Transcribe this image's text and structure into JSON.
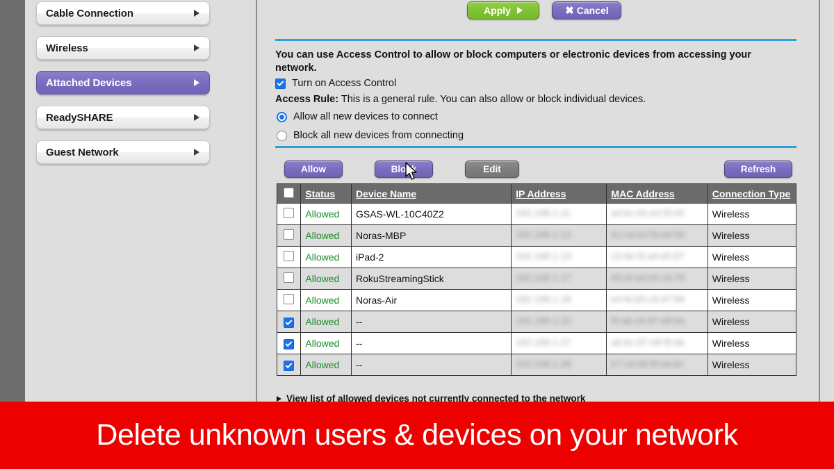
{
  "sidebar": {
    "items": [
      {
        "label": "Cable Connection",
        "active": false,
        "icon": "chevron-right-icon"
      },
      {
        "label": "Wireless",
        "active": false,
        "icon": "chevron-right-icon"
      },
      {
        "label": "Attached Devices",
        "active": true,
        "icon": "chevron-right-icon"
      },
      {
        "label": "ReadySHARE",
        "active": false,
        "icon": "chevron-right-icon"
      },
      {
        "label": "Guest Network",
        "active": false,
        "icon": "chevron-right-icon"
      }
    ]
  },
  "toolbar": {
    "apply_label": "Apply",
    "apply_icon": "play-triangle-icon",
    "apply_color": "#7fc236",
    "cancel_label": "Cancel",
    "cancel_icon": "x-close-icon",
    "cancel_color": "#7a6dc0"
  },
  "content": {
    "intro": "You can use Access Control to allow or block computers or electronic devices from accessing your network.",
    "turn_on_label": "Turn on Access Control",
    "turn_on_checked": true,
    "access_rule_label": "Access Rule:",
    "access_rule_text": " This is a general rule. You can also allow or block individual devices.",
    "radio_allow_label": "Allow all new devices to connect",
    "radio_block_label": "Block all new devices from connecting",
    "radio_selected": "allow",
    "rule_color": "#2e9fd4"
  },
  "actions": {
    "allow_label": "Allow",
    "block_label": "Block",
    "edit_label": "Edit",
    "refresh_label": "Refresh",
    "edit_disabled": true
  },
  "table": {
    "columns": [
      "",
      "Status",
      "Device Name",
      "IP Address",
      "MAC Address",
      "Connection Type"
    ],
    "header_select_all_checked": false,
    "status_color": "#1a8c2a",
    "rows": [
      {
        "checked": false,
        "status": "Allowed",
        "name": "GSAS-WL-10C40Z2",
        "ip": "192.168.1.11",
        "mac": "a0:bc:d1:e2:f3:45",
        "conn": "Wireless"
      },
      {
        "checked": false,
        "status": "Allowed",
        "name": "Noras-MBP",
        "ip": "192.168.1.12",
        "mac": "b1:cd:e2:f3:a4:56",
        "conn": "Wireless"
      },
      {
        "checked": false,
        "status": "Allowed",
        "name": "iPad-2",
        "ip": "192.168.1.13",
        "mac": "c2:de:f3:a4:b5:67",
        "conn": "Wireless"
      },
      {
        "checked": false,
        "status": "Allowed",
        "name": "RokuStreamingStick",
        "ip": "192.168.1.17",
        "mac": "d3:ef:a4:b5:c6:78",
        "conn": "Wireless"
      },
      {
        "checked": false,
        "status": "Allowed",
        "name": "Noras-Air",
        "ip": "192.168.1.18",
        "mac": "e4:fa:b5:c6:d7:89",
        "conn": "Wireless"
      },
      {
        "checked": true,
        "status": "Allowed",
        "name": "--",
        "ip": "192.168.1.22",
        "mac": "f5:ab:c6:d7:e8:9a",
        "conn": "Wireless"
      },
      {
        "checked": true,
        "status": "Allowed",
        "name": "--",
        "ip": "192.168.1.27",
        "mac": "a6:bc:d7:e8:f9:ab",
        "conn": "Wireless"
      },
      {
        "checked": true,
        "status": "Allowed",
        "name": "--",
        "ip": "192.168.1.28",
        "mac": "b7:cd:e8:f9:aa:bc",
        "conn": "Wireless"
      }
    ]
  },
  "footer": {
    "link_label": "View list of allowed devices not currently connected to the network",
    "link_icon": "triangle-right-icon"
  },
  "banner": {
    "caption": "Delete unknown users & devices on your network",
    "background": "#ed0000",
    "text_color": "#ffffff"
  }
}
